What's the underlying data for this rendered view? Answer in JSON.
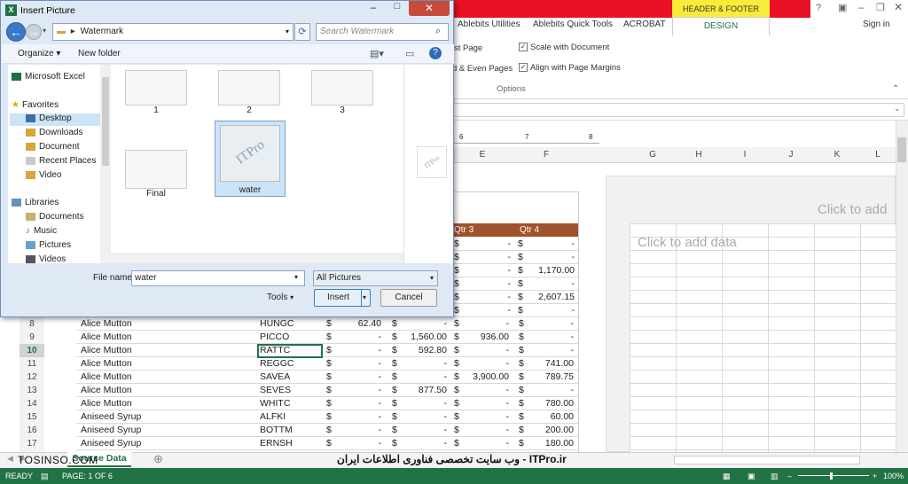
{
  "dialog": {
    "title": "Insert Picture",
    "address": "Watermark",
    "search_placeholder": "Search Watermark",
    "organize": "Organize",
    "new_folder": "New folder",
    "nav": {
      "top": "Microsoft Excel",
      "favorites": "Favorites",
      "fav_items": [
        "Desktop",
        "Downloads",
        "Document",
        "Recent Places",
        "Video"
      ],
      "libraries": "Libraries",
      "lib_items": [
        "Documents",
        "Music",
        "Pictures",
        "Videos"
      ]
    },
    "files": [
      "1",
      "2",
      "3",
      "Final",
      "water"
    ],
    "file_name_label": "File name:",
    "file_name": "water",
    "file_type": "All Pictures",
    "tools": "Tools",
    "insert": "Insert",
    "cancel": "Cancel",
    "preview_text": "ITPro"
  },
  "excel": {
    "header_footer_tools": "HEADER & FOOTER TOOLS",
    "design": "DESIGN",
    "sign_in": "Sign in",
    "ribbon_tabs": [
      "Ablebits Utilities",
      "Ablebits Quick Tools",
      "ACROBAT"
    ],
    "options": {
      "first_page_partial": "st Page",
      "odd_even_partial": "d & Even Pages",
      "scale": "Scale with Document",
      "align": "Align with Page Margins",
      "group": "Options"
    },
    "columns_left": [
      "E",
      "F"
    ],
    "columns_right": [
      "G",
      "H",
      "I",
      "J",
      "K",
      "L"
    ],
    "placeholders": {
      "data": "Click to add data",
      "header": "Click to add"
    },
    "ruler_nums": [
      "6",
      "7",
      "8"
    ],
    "tbl_header": [
      "Qtr 3",
      "Qtr 4"
    ],
    "rows": [
      {
        "n": "8",
        "name": "Alice Mutton",
        "code": "HUNGC",
        "c": "62.40",
        "d": "-",
        "e": "-",
        "f": "-"
      },
      {
        "n": "9",
        "name": "Alice Mutton",
        "code": "PICCO",
        "c": "-",
        "d": "1,560.00",
        "e": "936.00",
        "f": "-"
      },
      {
        "n": "10",
        "name": "Alice Mutton",
        "code": "RATTC",
        "c": "-",
        "d": "592.80",
        "e": "-",
        "f": "-"
      },
      {
        "n": "11",
        "name": "Alice Mutton",
        "code": "REGGC",
        "c": "-",
        "d": "-",
        "e": "-",
        "f": "741.00"
      },
      {
        "n": "12",
        "name": "Alice Mutton",
        "code": "SAVEA",
        "c": "-",
        "d": "-",
        "e": "3,900.00",
        "f": "789.75"
      },
      {
        "n": "13",
        "name": "Alice Mutton",
        "code": "SEVES",
        "c": "-",
        "d": "877.50",
        "e": "-",
        "f": "-"
      },
      {
        "n": "14",
        "name": "Alice Mutton",
        "code": "WHITC",
        "c": "-",
        "d": "-",
        "e": "-",
        "f": "780.00"
      },
      {
        "n": "15",
        "name": "Aniseed Syrup",
        "code": "ALFKI",
        "c": "-",
        "d": "-",
        "e": "-",
        "f": "60.00"
      },
      {
        "n": "16",
        "name": "Aniseed Syrup",
        "code": "BOTTM",
        "c": "-",
        "d": "-",
        "e": "-",
        "f": "200.00"
      },
      {
        "n": "17",
        "name": "Aniseed Syrup",
        "code": "ERNSH",
        "c": "-",
        "d": "-",
        "e": "-",
        "f": "180.00"
      }
    ],
    "upper_rows": [
      {
        "e": "-",
        "f": "-"
      },
      {
        "e": "-",
        "f": "-"
      },
      {
        "e": "-",
        "f": "1,170.00"
      },
      {
        "e": "-",
        "f": "-"
      },
      {
        "e": "-",
        "f": "2,607.15"
      },
      {
        "e": "-",
        "f": "-"
      }
    ],
    "sheet_tab": "Source Data",
    "status": {
      "ready": "READY",
      "page": "PAGE: 1 OF 6",
      "zoom": "100%"
    }
  },
  "overlay": {
    "watermark": "TOSINSO.COM",
    "arabic": "وب سایت تخصصی فناوری اطلاعات ایران - ITPro.ir"
  }
}
